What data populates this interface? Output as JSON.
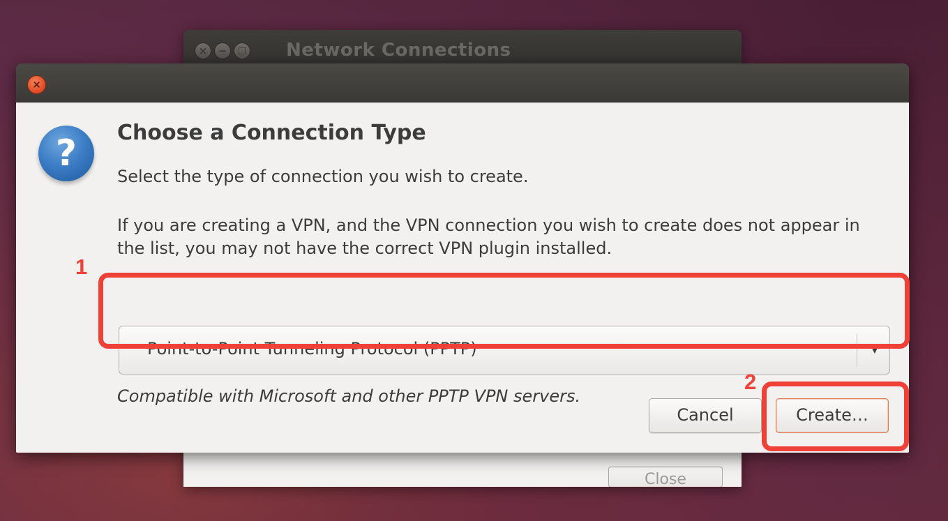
{
  "background_window": {
    "title": "Network Connections",
    "close_label": "Close",
    "buttons": {
      "close_glyph": "×",
      "minimize_glyph": "−",
      "maximize_glyph": "□"
    }
  },
  "dialog": {
    "close_glyph": "×",
    "icon": "question-icon",
    "icon_glyph": "?",
    "heading": "Choose a Connection Type",
    "subtitle": "Select the type of connection you wish to create.",
    "note": "If you are creating a VPN, and the VPN connection you wish to create does not appear in the list, you may not have the correct VPN plugin installed.",
    "connection_type": {
      "selected": "Point-to-Point Tunneling Protocol (PPTP)",
      "arrow_glyph": "▼"
    },
    "hint": "Compatible with Microsoft and other PPTP VPN servers.",
    "cancel_label": "Cancel",
    "create_label": "Create…"
  },
  "annotations": [
    {
      "number": "1",
      "color": "#ef4137"
    },
    {
      "number": "2",
      "color": "#ef4137"
    }
  ],
  "colors": {
    "accent_orange": "#e3502a",
    "annotation_red": "#ef4137",
    "dialog_bg": "#f2f1f0",
    "titlebar": "#3b3935"
  }
}
